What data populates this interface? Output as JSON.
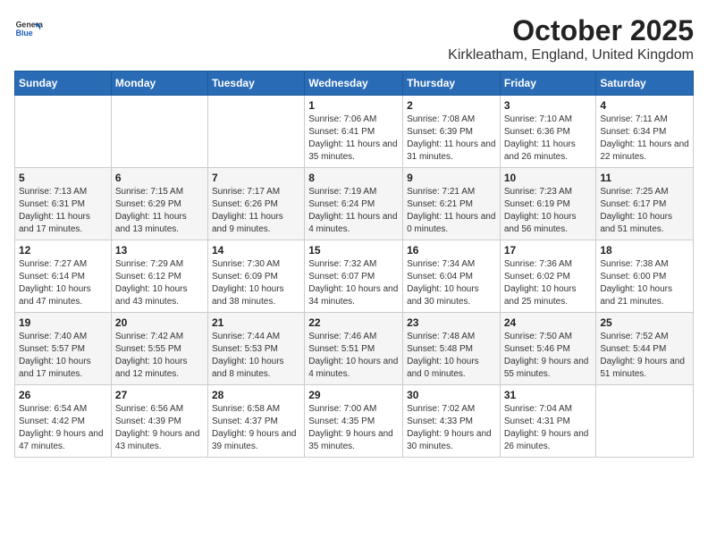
{
  "header": {
    "logo_general": "General",
    "logo_blue": "Blue",
    "title": "October 2025",
    "subtitle": "Kirkleatham, England, United Kingdom"
  },
  "days_of_week": [
    "Sunday",
    "Monday",
    "Tuesday",
    "Wednesday",
    "Thursday",
    "Friday",
    "Saturday"
  ],
  "weeks": [
    [
      {
        "day": "",
        "info": ""
      },
      {
        "day": "",
        "info": ""
      },
      {
        "day": "",
        "info": ""
      },
      {
        "day": "1",
        "info": "Sunrise: 7:06 AM\nSunset: 6:41 PM\nDaylight: 11 hours and 35 minutes."
      },
      {
        "day": "2",
        "info": "Sunrise: 7:08 AM\nSunset: 6:39 PM\nDaylight: 11 hours and 31 minutes."
      },
      {
        "day": "3",
        "info": "Sunrise: 7:10 AM\nSunset: 6:36 PM\nDaylight: 11 hours and 26 minutes."
      },
      {
        "day": "4",
        "info": "Sunrise: 7:11 AM\nSunset: 6:34 PM\nDaylight: 11 hours and 22 minutes."
      }
    ],
    [
      {
        "day": "5",
        "info": "Sunrise: 7:13 AM\nSunset: 6:31 PM\nDaylight: 11 hours and 17 minutes."
      },
      {
        "day": "6",
        "info": "Sunrise: 7:15 AM\nSunset: 6:29 PM\nDaylight: 11 hours and 13 minutes."
      },
      {
        "day": "7",
        "info": "Sunrise: 7:17 AM\nSunset: 6:26 PM\nDaylight: 11 hours and 9 minutes."
      },
      {
        "day": "8",
        "info": "Sunrise: 7:19 AM\nSunset: 6:24 PM\nDaylight: 11 hours and 4 minutes."
      },
      {
        "day": "9",
        "info": "Sunrise: 7:21 AM\nSunset: 6:21 PM\nDaylight: 11 hours and 0 minutes."
      },
      {
        "day": "10",
        "info": "Sunrise: 7:23 AM\nSunset: 6:19 PM\nDaylight: 10 hours and 56 minutes."
      },
      {
        "day": "11",
        "info": "Sunrise: 7:25 AM\nSunset: 6:17 PM\nDaylight: 10 hours and 51 minutes."
      }
    ],
    [
      {
        "day": "12",
        "info": "Sunrise: 7:27 AM\nSunset: 6:14 PM\nDaylight: 10 hours and 47 minutes."
      },
      {
        "day": "13",
        "info": "Sunrise: 7:29 AM\nSunset: 6:12 PM\nDaylight: 10 hours and 43 minutes."
      },
      {
        "day": "14",
        "info": "Sunrise: 7:30 AM\nSunset: 6:09 PM\nDaylight: 10 hours and 38 minutes."
      },
      {
        "day": "15",
        "info": "Sunrise: 7:32 AM\nSunset: 6:07 PM\nDaylight: 10 hours and 34 minutes."
      },
      {
        "day": "16",
        "info": "Sunrise: 7:34 AM\nSunset: 6:04 PM\nDaylight: 10 hours and 30 minutes."
      },
      {
        "day": "17",
        "info": "Sunrise: 7:36 AM\nSunset: 6:02 PM\nDaylight: 10 hours and 25 minutes."
      },
      {
        "day": "18",
        "info": "Sunrise: 7:38 AM\nSunset: 6:00 PM\nDaylight: 10 hours and 21 minutes."
      }
    ],
    [
      {
        "day": "19",
        "info": "Sunrise: 7:40 AM\nSunset: 5:57 PM\nDaylight: 10 hours and 17 minutes."
      },
      {
        "day": "20",
        "info": "Sunrise: 7:42 AM\nSunset: 5:55 PM\nDaylight: 10 hours and 12 minutes."
      },
      {
        "day": "21",
        "info": "Sunrise: 7:44 AM\nSunset: 5:53 PM\nDaylight: 10 hours and 8 minutes."
      },
      {
        "day": "22",
        "info": "Sunrise: 7:46 AM\nSunset: 5:51 PM\nDaylight: 10 hours and 4 minutes."
      },
      {
        "day": "23",
        "info": "Sunrise: 7:48 AM\nSunset: 5:48 PM\nDaylight: 10 hours and 0 minutes."
      },
      {
        "day": "24",
        "info": "Sunrise: 7:50 AM\nSunset: 5:46 PM\nDaylight: 9 hours and 55 minutes."
      },
      {
        "day": "25",
        "info": "Sunrise: 7:52 AM\nSunset: 5:44 PM\nDaylight: 9 hours and 51 minutes."
      }
    ],
    [
      {
        "day": "26",
        "info": "Sunrise: 6:54 AM\nSunset: 4:42 PM\nDaylight: 9 hours and 47 minutes."
      },
      {
        "day": "27",
        "info": "Sunrise: 6:56 AM\nSunset: 4:39 PM\nDaylight: 9 hours and 43 minutes."
      },
      {
        "day": "28",
        "info": "Sunrise: 6:58 AM\nSunset: 4:37 PM\nDaylight: 9 hours and 39 minutes."
      },
      {
        "day": "29",
        "info": "Sunrise: 7:00 AM\nSunset: 4:35 PM\nDaylight: 9 hours and 35 minutes."
      },
      {
        "day": "30",
        "info": "Sunrise: 7:02 AM\nSunset: 4:33 PM\nDaylight: 9 hours and 30 minutes."
      },
      {
        "day": "31",
        "info": "Sunrise: 7:04 AM\nSunset: 4:31 PM\nDaylight: 9 hours and 26 minutes."
      },
      {
        "day": "",
        "info": ""
      }
    ]
  ]
}
